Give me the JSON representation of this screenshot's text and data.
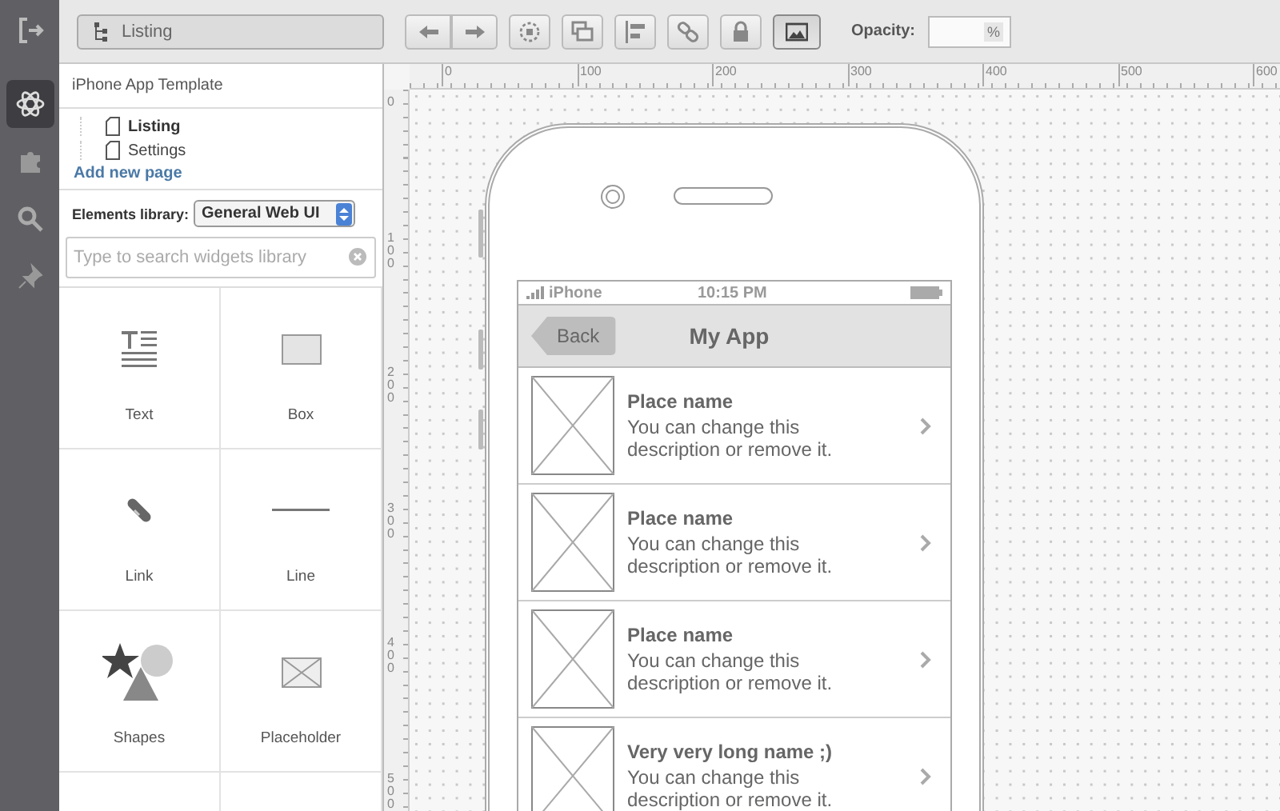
{
  "rail": [
    {
      "kind": "exit",
      "selected": false
    },
    {
      "kind": "atom",
      "selected": true
    },
    {
      "kind": "puzzle",
      "selected": false
    },
    {
      "kind": "search",
      "selected": false
    },
    {
      "kind": "pin",
      "selected": false
    }
  ],
  "toolbar": {
    "breadcrumb": "Listing",
    "buttons": [
      {
        "kind": "undo",
        "selected": false
      },
      {
        "kind": "redo",
        "selected": false
      },
      {
        "kind": "group",
        "selected": false
      },
      {
        "kind": "duplicate",
        "selected": false
      },
      {
        "kind": "align",
        "selected": false
      },
      {
        "kind": "link",
        "selected": false
      },
      {
        "kind": "lock",
        "selected": false
      },
      {
        "kind": "image",
        "selected": true
      }
    ],
    "opacity_label": "Opacity:",
    "opacity_unit": "%"
  },
  "sidebar": {
    "project": "iPhone App Template",
    "pages": [
      {
        "label": "Listing",
        "selected": true
      },
      {
        "label": "Settings",
        "selected": false
      }
    ],
    "add_page": "Add new page",
    "library_label": "Elements library:",
    "library_value": "General Web UI",
    "search": {
      "placeholder": "Type to search widgets library"
    },
    "widgets": [
      {
        "kind": "text",
        "label": "Text"
      },
      {
        "kind": "box",
        "label": "Box"
      },
      {
        "kind": "link",
        "label": "Link"
      },
      {
        "kind": "line",
        "label": "Line"
      },
      {
        "kind": "shapes",
        "label": "Shapes"
      },
      {
        "kind": "placeholder",
        "label": "Placeholder"
      },
      {
        "kind": "empty"
      },
      {
        "kind": "empty"
      }
    ]
  },
  "ruler": {
    "x_labels": [
      "0",
      "100",
      "200",
      "300",
      "400",
      "500",
      "600"
    ],
    "y_labels": [
      "0",
      "100",
      "200",
      "300",
      "400",
      "500"
    ]
  },
  "phone": {
    "carrier": "iPhone",
    "time": "10:15 PM",
    "back": "Back",
    "title": "My App",
    "rows": [
      {
        "name": "Place name",
        "description": "You can change this description or remove it."
      },
      {
        "name": "Place name",
        "description": "You can change this description or remove it."
      },
      {
        "name": "Place name",
        "description": "You can change this description or remove it."
      },
      {
        "name": "Very very long name ;)",
        "description": "You can change this description or remove it."
      }
    ]
  }
}
